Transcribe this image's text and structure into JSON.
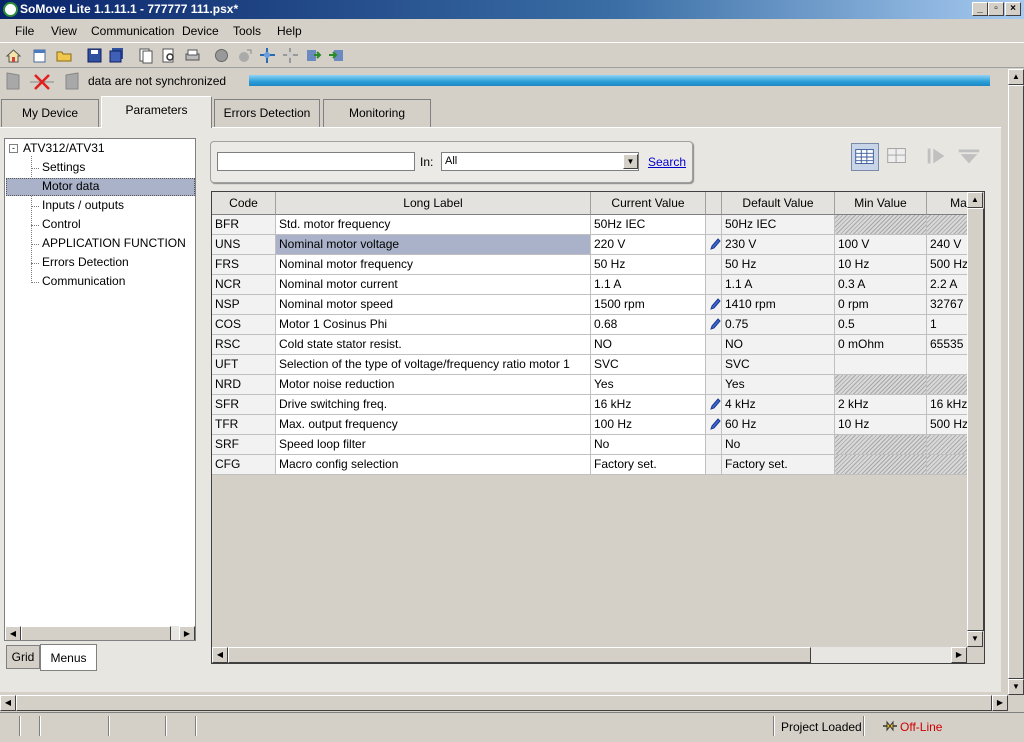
{
  "window": {
    "title": "SoMove Lite 1.1.11.1 - 777777 111.psx*"
  },
  "menu": [
    "File",
    "View",
    "Communication",
    "Device",
    "Tools",
    "Help"
  ],
  "toolbar_icons": [
    "home-icon",
    "new-icon",
    "open-folder-icon",
    "save-icon",
    "save-all-icon",
    "copy-icon",
    "print-preview-icon",
    "print-icon",
    "stop-icon",
    "connect-icon",
    "disconnect-icon",
    "transfer-icon",
    "upload-icon",
    "download-icon"
  ],
  "sync": {
    "message": "data are not synchronized"
  },
  "tabs": [
    {
      "label": "My Device",
      "active": false
    },
    {
      "label": "Parameters",
      "active": true
    },
    {
      "label": "Errors Detection",
      "active": false
    },
    {
      "label": "Monitoring",
      "active": false
    }
  ],
  "tree": {
    "root": "ATV312/ATV31",
    "items": [
      "Settings",
      "Motor data",
      "Inputs / outputs",
      "Control",
      "APPLICATION FUNCTION",
      "Errors Detection",
      "Communication"
    ],
    "selected_index": 1
  },
  "bottom_tabs": [
    {
      "label": "Grid",
      "active": false
    },
    {
      "label": "Menus",
      "active": true
    }
  ],
  "search": {
    "input_value": "",
    "in_label": "In:",
    "in_value": "All",
    "button_label": "Search"
  },
  "table": {
    "headers": [
      "Code",
      "Long Label",
      "Current Value",
      "",
      "Default Value",
      "Min Value",
      "Max"
    ],
    "rows": [
      {
        "code": "BFR",
        "label": "Std. motor frequency",
        "current": "50Hz IEC",
        "edited": false,
        "default": "50Hz IEC",
        "min": "",
        "max": "",
        "hatched": true
      },
      {
        "code": "UNS",
        "label": "Nominal motor voltage",
        "current": "220 V",
        "edited": true,
        "default": "230 V",
        "min": "100 V",
        "max": "240 V",
        "hatched": false,
        "selected": true
      },
      {
        "code": "FRS",
        "label": "Nominal motor frequency",
        "current": "50 Hz",
        "edited": false,
        "default": "50 Hz",
        "min": "10 Hz",
        "max": "500 Hz",
        "hatched": false
      },
      {
        "code": "NCR",
        "label": "Nominal motor current",
        "current": "1.1 A",
        "edited": false,
        "default": "1.1 A",
        "min": "0.3 A",
        "max": "2.2 A",
        "hatched": false
      },
      {
        "code": "NSP",
        "label": "Nominal motor speed",
        "current": "1500 rpm",
        "edited": true,
        "default": "1410 rpm",
        "min": "0 rpm",
        "max": "32767",
        "hatched": false
      },
      {
        "code": "COS",
        "label": "Motor 1 Cosinus Phi",
        "current": "0.68",
        "edited": true,
        "default": "0.75",
        "min": "0.5",
        "max": "1",
        "hatched": false
      },
      {
        "code": "RSC",
        "label": "Cold state stator resist.",
        "current": "NO",
        "edited": false,
        "default": "NO",
        "min": "0 mOhm",
        "max": "65535",
        "hatched": false
      },
      {
        "code": "UFT",
        "label": "Selection of the type of voltage/frequency ratio motor 1",
        "current": "SVC",
        "edited": false,
        "default": "SVC",
        "min": "",
        "max": "",
        "hatched": false
      },
      {
        "code": "NRD",
        "label": "Motor noise reduction",
        "current": "Yes",
        "edited": false,
        "default": "Yes",
        "min": "",
        "max": "",
        "hatched": true
      },
      {
        "code": "SFR",
        "label": "Drive switching freq.",
        "current": "16 kHz",
        "edited": true,
        "default": "4 kHz",
        "min": "2 kHz",
        "max": "16 kHz",
        "hatched": false
      },
      {
        "code": "TFR",
        "label": "Max. output frequency",
        "current": "100 Hz",
        "edited": true,
        "default": "60 Hz",
        "min": "10 Hz",
        "max": "500 Hz",
        "hatched": false
      },
      {
        "code": "SRF",
        "label": "Speed loop filter",
        "current": "No",
        "edited": false,
        "default": "No",
        "min": "",
        "max": "",
        "hatched": true
      },
      {
        "code": "CFG",
        "label": "Macro config selection",
        "current": "Factory set.",
        "edited": false,
        "default": "Factory set.",
        "min": "",
        "max": "",
        "hatched": true
      }
    ]
  },
  "status": {
    "project": "Project Loaded",
    "connection": "Off-Line"
  }
}
